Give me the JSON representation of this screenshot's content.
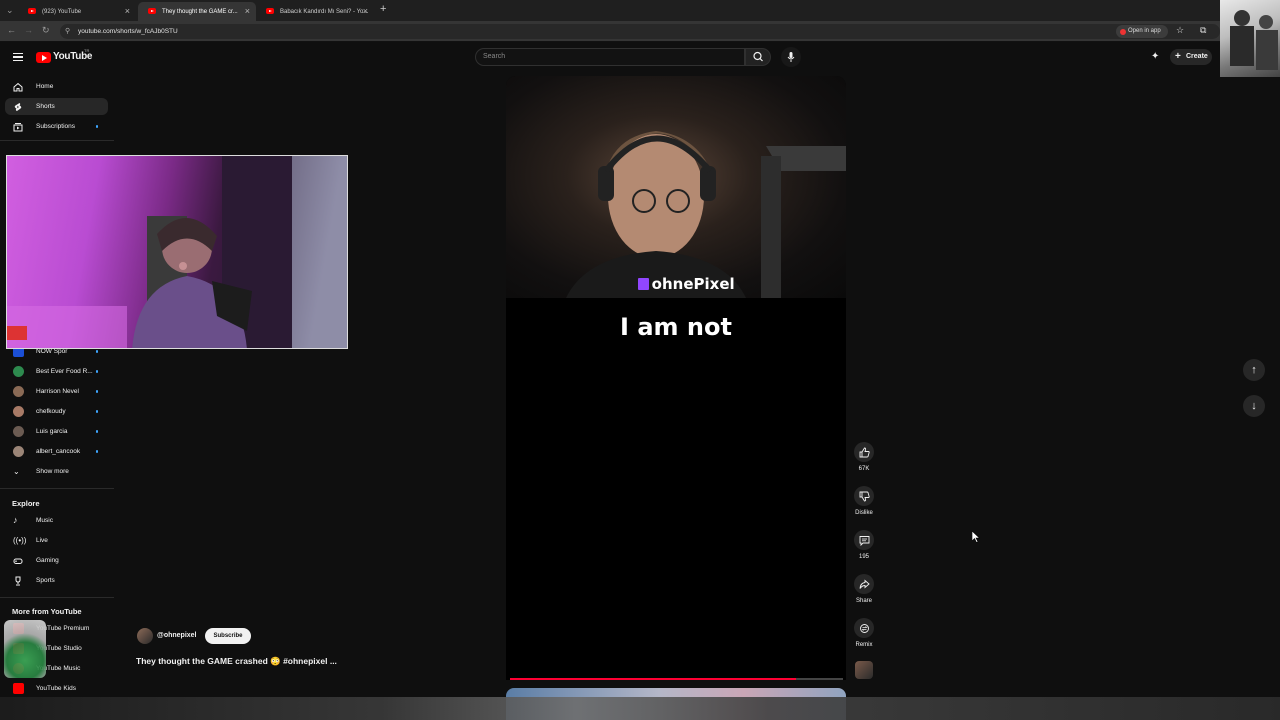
{
  "browser": {
    "tabs": [
      {
        "label": "(923) YouTube"
      },
      {
        "label": "They thought the GAME cr..."
      },
      {
        "label": "Babacık Kandırdı Mı Seni? - Yo..."
      }
    ],
    "url": "youtube.com/shorts/w_fcAJb0STU",
    "open_in_app": "Open in app"
  },
  "header": {
    "logo": "YouTube",
    "logo_region": "TR",
    "search_placeholder": "Search",
    "create_label": "Create"
  },
  "sidebar": {
    "main": [
      {
        "label": "Home",
        "icon": "home-icon"
      },
      {
        "label": "Shorts",
        "icon": "shorts-icon"
      },
      {
        "label": "Subscriptions",
        "icon": "subscriptions-icon"
      }
    ],
    "subscriptions": [
      {
        "label": "NOW Spor"
      },
      {
        "label": "Best Ever Food R..."
      },
      {
        "label": "Harrison Nevel"
      },
      {
        "label": "chefkoudy"
      },
      {
        "label": "Luis garcia"
      },
      {
        "label": "albert_cancook"
      }
    ],
    "show_more": "Show more",
    "explore_title": "Explore",
    "explore": [
      {
        "label": "Music",
        "icon": "music-icon"
      },
      {
        "label": "Live",
        "icon": "live-icon"
      },
      {
        "label": "Gaming",
        "icon": "gaming-icon"
      },
      {
        "label": "Sports",
        "icon": "sports-icon"
      }
    ],
    "more_title": "More from YouTube",
    "more": [
      {
        "label": "YouTube Premium"
      },
      {
        "label": "YouTube Studio"
      },
      {
        "label": "YouTube Music"
      },
      {
        "label": "YouTube Kids"
      }
    ]
  },
  "short": {
    "streamer_overlay": "ohnePixel",
    "caption": "I am not",
    "channel": "@ohnepixel",
    "subscribe": "Subscribe",
    "title": "They thought the GAME crashed 😳 #ohnepixel ...",
    "progress": 0.86
  },
  "actions": {
    "like_count": "67K",
    "dislike_label": "Dislike",
    "comments_count": "195",
    "share_label": "Share",
    "remix_label": "Remix"
  },
  "colors": {
    "accent_red": "#ff0000",
    "twitch_purple": "#9146ff",
    "background": "#0f0f0f"
  }
}
